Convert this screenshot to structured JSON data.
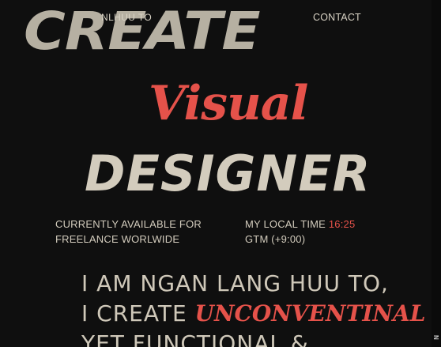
{
  "background": {
    "watermark_word": "CREATE"
  },
  "nav": {
    "name": "NLHUU TO",
    "contact": "CONTACT"
  },
  "hero": {
    "line1": "Visual",
    "line2": "DESIGNER"
  },
  "info": {
    "availability_line1": "CURRENTLY AVAILABLE FOR",
    "availability_line2": "FREELANCE WORLWIDE",
    "local_time_label": "MY LOCAL TIME",
    "local_time_value": "16:25",
    "timezone": "GTM (+9:00)"
  },
  "intro": {
    "line1": "I AM NGAN LANG HUU TO,",
    "line2_prefix": "I CREATE",
    "line2_accent": "UNCONVENTINAL",
    "line3": "YET FUNCTIONAL &"
  },
  "colors": {
    "background": "#0f0f0f",
    "text": "#d3ccbd",
    "accent": "#e5524a"
  },
  "side_mark": "N"
}
